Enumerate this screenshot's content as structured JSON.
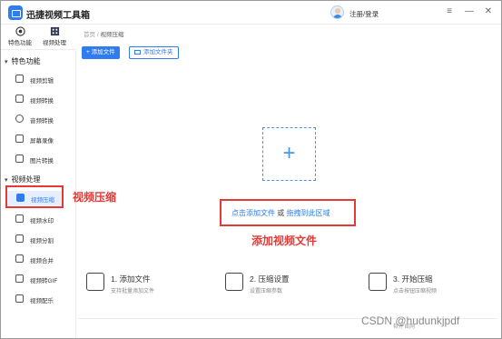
{
  "app": {
    "title": "迅捷视频工具箱",
    "login": "注册/登录"
  },
  "modes": [
    {
      "label": "特色功能"
    },
    {
      "label": "视频处理"
    }
  ],
  "sidebar": {
    "groups": [
      {
        "label": "特色功能"
      },
      {
        "label": "视频处理"
      }
    ],
    "feature_items": [
      {
        "label": "视频剪辑"
      },
      {
        "label": "视频转换"
      },
      {
        "label": "音频转换"
      },
      {
        "label": "屏幕录像"
      },
      {
        "label": "图片转换"
      }
    ],
    "video_items": [
      {
        "label": "视频压缩",
        "active": true
      },
      {
        "label": "视频水印"
      },
      {
        "label": "视频分割"
      },
      {
        "label": "视频合并"
      },
      {
        "label": "视频转GIF"
      },
      {
        "label": "视频配乐"
      }
    ]
  },
  "breadcrumb": {
    "home": "首页",
    "sep": "/",
    "current": "视频压缩"
  },
  "toolbar": {
    "add_file": "+ 添加文件",
    "add_folder": "添加文件夹"
  },
  "dropzone": {
    "plus": "+",
    "hint_link1": "点击添加文件",
    "hint_or": " 或 ",
    "hint_link2": "拖拽到此区域"
  },
  "annotations": {
    "compress": "视频压缩",
    "add_file": "添加视频文件"
  },
  "steps": [
    {
      "title": "1. 添加文件",
      "desc": "支持批量添加文件"
    },
    {
      "title": "2. 压缩设置",
      "desc": "设置压缩参数"
    },
    {
      "title": "3. 开始压缩",
      "desc": "点击按钮压缩视频"
    }
  ],
  "footer": {
    "text": "软件官网",
    "watermark": "CSDN @hudunkjpdf"
  },
  "colors": {
    "accent": "#2f7bf0",
    "annotation": "#e53935"
  }
}
